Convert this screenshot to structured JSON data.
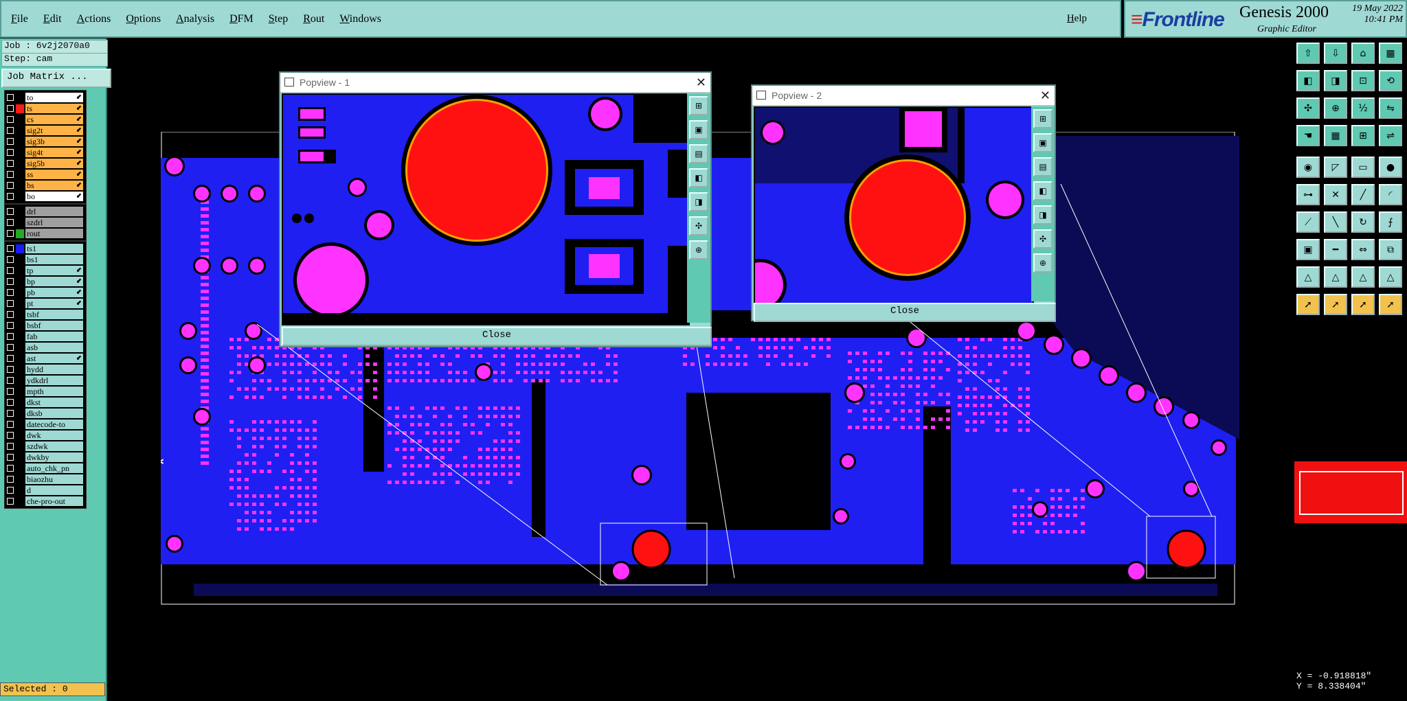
{
  "menu": {
    "items": [
      "File",
      "Edit",
      "Actions",
      "Options",
      "Analysis",
      "DFM",
      "Step",
      "Rout",
      "Windows"
    ],
    "help": "Help"
  },
  "brand": {
    "logo": "Frontline",
    "product": "Genesis 2000",
    "subtitle": "Graphic Editor",
    "date": "19 May 2022",
    "time": "10:41 PM"
  },
  "left_panel": {
    "job": "Job : 6v2j2070a0",
    "step": "Step: cam",
    "matrix_button": "Job Matrix ...",
    "layers_group1": [
      {
        "name": "to",
        "color": "#000000",
        "bg": "#ffffff",
        "tick": true
      },
      {
        "name": "ts",
        "color": "#ff1a1a",
        "bg": "#ffb347",
        "tick": true
      },
      {
        "name": "cs",
        "color": "#000000",
        "bg": "#ffb347",
        "tick": true
      },
      {
        "name": "sig2t",
        "color": "#000000",
        "bg": "#ffb347",
        "tick": true
      },
      {
        "name": "sig3b",
        "color": "#000000",
        "bg": "#ffb347",
        "tick": true
      },
      {
        "name": "sig4t",
        "color": "#000000",
        "bg": "#ffb347",
        "tick": true
      },
      {
        "name": "sig5b",
        "color": "#000000",
        "bg": "#ffb347",
        "tick": true
      },
      {
        "name": "ss",
        "color": "#000000",
        "bg": "#ffb347",
        "tick": true
      },
      {
        "name": "bs",
        "color": "#000000",
        "bg": "#ffb347",
        "tick": true
      },
      {
        "name": "bo",
        "color": "#000000",
        "bg": "#ffffff",
        "tick": true
      }
    ],
    "layers_group2": [
      {
        "name": "drl",
        "color": "#000000",
        "bg": "#a0a0a0",
        "tick": false
      },
      {
        "name": "szdrl",
        "color": "#000000",
        "bg": "#a0a0a0",
        "tick": false
      },
      {
        "name": "rout",
        "color": "#22aa22",
        "bg": "#a0a0a0",
        "tick": false
      }
    ],
    "layers_group3": [
      {
        "name": "ts1",
        "color": "#1a1aff",
        "bg": "#9fd9d4",
        "tick": false
      },
      {
        "name": "bs1",
        "color": "#000000",
        "bg": "#9fd9d4",
        "tick": false
      },
      {
        "name": "tp",
        "color": "#000000",
        "bg": "#9fd9d4",
        "tick": true
      },
      {
        "name": "bp",
        "color": "#000000",
        "bg": "#9fd9d4",
        "tick": true
      },
      {
        "name": "pb",
        "color": "#000000",
        "bg": "#9fd9d4",
        "tick": true
      },
      {
        "name": "pt",
        "color": "#000000",
        "bg": "#9fd9d4",
        "tick": true
      },
      {
        "name": "tsbf",
        "color": "#000000",
        "bg": "#9fd9d4",
        "tick": false
      },
      {
        "name": "bsbf",
        "color": "#000000",
        "bg": "#9fd9d4",
        "tick": false
      },
      {
        "name": "fab",
        "color": "#000000",
        "bg": "#9fd9d4",
        "tick": false
      },
      {
        "name": "asb",
        "color": "#000000",
        "bg": "#9fd9d4",
        "tick": false
      },
      {
        "name": "ast",
        "color": "#000000",
        "bg": "#9fd9d4",
        "tick": true
      },
      {
        "name": "hydd",
        "color": "#000000",
        "bg": "#9fd9d4",
        "tick": false
      },
      {
        "name": "ydkdrl",
        "color": "#000000",
        "bg": "#9fd9d4",
        "tick": false
      },
      {
        "name": "mpth",
        "color": "#000000",
        "bg": "#9fd9d4",
        "tick": false
      },
      {
        "name": "dkst",
        "color": "#000000",
        "bg": "#9fd9d4",
        "tick": false
      },
      {
        "name": "dksb",
        "color": "#000000",
        "bg": "#9fd9d4",
        "tick": false
      },
      {
        "name": "datecode-to",
        "color": "#000000",
        "bg": "#9fd9d4",
        "tick": false
      },
      {
        "name": "dwk",
        "color": "#000000",
        "bg": "#9fd9d4",
        "tick": false
      },
      {
        "name": "szdwk",
        "color": "#000000",
        "bg": "#9fd9d4",
        "tick": false
      },
      {
        "name": "dwkby",
        "color": "#000000",
        "bg": "#9fd9d4",
        "tick": false
      },
      {
        "name": "auto_chk_pn",
        "color": "#000000",
        "bg": "#9fd9d4",
        "tick": false
      },
      {
        "name": "biaozhu",
        "color": "#000000",
        "bg": "#9fd9d4",
        "tick": false
      },
      {
        "name": "d",
        "color": "#000000",
        "bg": "#9fd9d4",
        "tick": false
      },
      {
        "name": "che-pro-out",
        "color": "#000000",
        "bg": "#9fd9d4",
        "tick": false
      }
    ],
    "selected": "Selected : 0"
  },
  "popup1": {
    "title": "Popview - 1",
    "close": "Close"
  },
  "popup2": {
    "title": "Popview - 2",
    "close": "Close"
  },
  "coords": {
    "x": "X = -0.918818\"",
    "y": "Y = 8.338404\""
  },
  "colors": {
    "copper": "#1f1ff2",
    "pad": "#ff33ff",
    "drill": "#ff1111",
    "panel": "#5fc9b2",
    "menubar": "#9fd9d4"
  },
  "toolbox_icons": [
    "move-up-icon",
    "move-down-icon",
    "home-icon",
    "layout-icon",
    "zoom-left-icon",
    "zoom-right-icon",
    "pan-icon",
    "redraw-icon",
    "fit-icon",
    "center-icon",
    "scale-icon",
    "mirror-icon",
    "hand-icon",
    "grid-icon",
    "snap-icon",
    "route-icon",
    "select-icon",
    "polygon-icon",
    "measure-icon",
    "circle-icon",
    "node-icon",
    "cross-icon",
    "line-icon",
    "arc-icon",
    "draw-icon",
    "slash-icon",
    "rotate-icon",
    "text-icon",
    "pad-icon",
    "minus-icon",
    "resize-icon",
    "copy-icon",
    "triangle-icon",
    "triangle-a-icon",
    "triangle-b-icon",
    "triangle-c-icon",
    "pointer-icon",
    "pointer-plus-icon",
    "pointer-target-icon",
    "pointer-multi-icon"
  ]
}
